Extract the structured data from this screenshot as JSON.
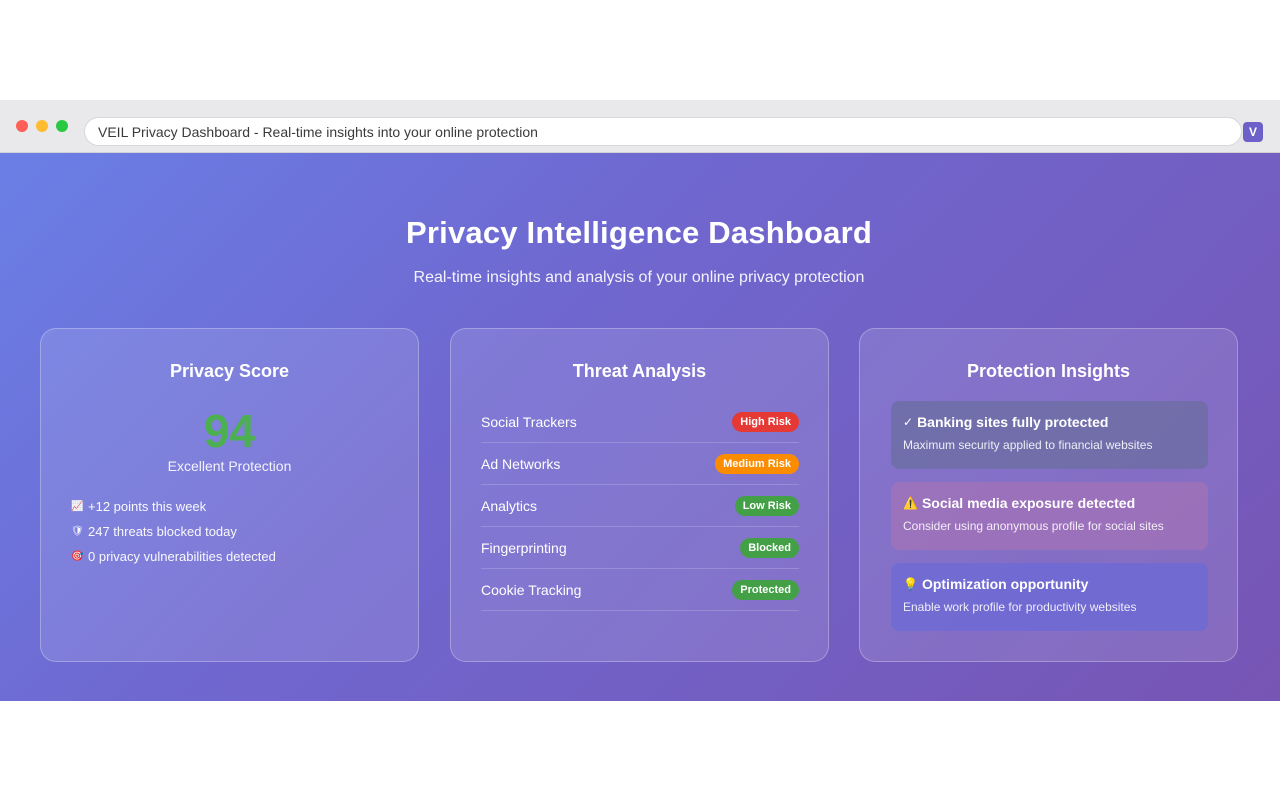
{
  "window": {
    "address_text": "VEIL Privacy Dashboard - Real-time insights into your online protection",
    "extension_label": "V"
  },
  "header": {
    "title": "Privacy Intelligence Dashboard",
    "subtitle": "Real-time insights and analysis of your online privacy protection"
  },
  "privacy_score": {
    "title": "Privacy Score",
    "value": "94",
    "label": "Excellent Protection",
    "stats": [
      {
        "icon": "📈",
        "icon_name": "chart-up-icon",
        "text": "+12 points this week"
      },
      {
        "icon": "🛡",
        "icon_name": "shield-icon",
        "text": "247 threats blocked today"
      },
      {
        "icon": "🎯",
        "icon_name": "target-icon",
        "text": "0 privacy vulnerabilities detected"
      }
    ]
  },
  "threat_analysis": {
    "title": "Threat Analysis",
    "rows": [
      {
        "name": "Social Trackers",
        "status": "High Risk",
        "color": "#e53935"
      },
      {
        "name": "Ad Networks",
        "status": "Medium Risk",
        "color": "#fb8c00"
      },
      {
        "name": "Analytics",
        "status": "Low Risk",
        "color": "#43a047"
      },
      {
        "name": "Fingerprinting",
        "status": "Blocked",
        "color": "#43a047"
      },
      {
        "name": "Cookie Tracking",
        "status": "Protected",
        "color": "#43a047"
      }
    ]
  },
  "protection_insights": {
    "title": "Protection Insights",
    "items": [
      {
        "icon": "✓",
        "icon_name": "checkmark-icon",
        "title": "Banking sites fully protected",
        "desc": "Maximum security applied to financial websites"
      },
      {
        "icon": "⚠️",
        "icon_name": "warning-icon",
        "title": "Social media exposure detected",
        "desc": "Consider using anonymous profile for social sites"
      },
      {
        "icon": "💡",
        "icon_name": "lightbulb-icon",
        "title": "Optimization opportunity",
        "desc": "Enable work profile for productivity websites"
      }
    ]
  },
  "colors": {
    "score": "#4caf50",
    "gradient_start": "#6a7fe6",
    "gradient_end": "#7755b4"
  }
}
